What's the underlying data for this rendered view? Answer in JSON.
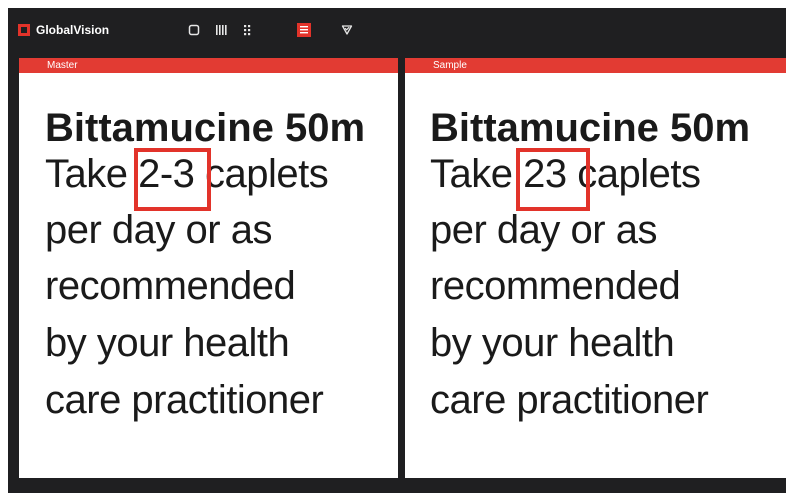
{
  "app": {
    "brand": "GlobalVision",
    "toolbar_icons": [
      "panel-icon",
      "columns-icon",
      "grid-icon",
      "text-compare-icon",
      "shield-check-icon"
    ],
    "active_tool": "text-compare-icon",
    "accent_color": "#e2332a"
  },
  "panes": {
    "master": {
      "label": "Master",
      "title": "Bittamucine 50m",
      "line1_before": "Take ",
      "line1_diff": "2-3",
      "line1_after": " caplets",
      "line2": "per day or as",
      "line3": "recommended",
      "line4": "by your health",
      "line5": "care practitioner"
    },
    "sample": {
      "label": "Sample",
      "title": "Bittamucine 50m",
      "line1_before": "Take ",
      "line1_diff": "23",
      "line1_after": " caplets",
      "line2": "per day or as",
      "line3": "recommended",
      "line4": "by your health",
      "line5": "care practitioner"
    }
  }
}
